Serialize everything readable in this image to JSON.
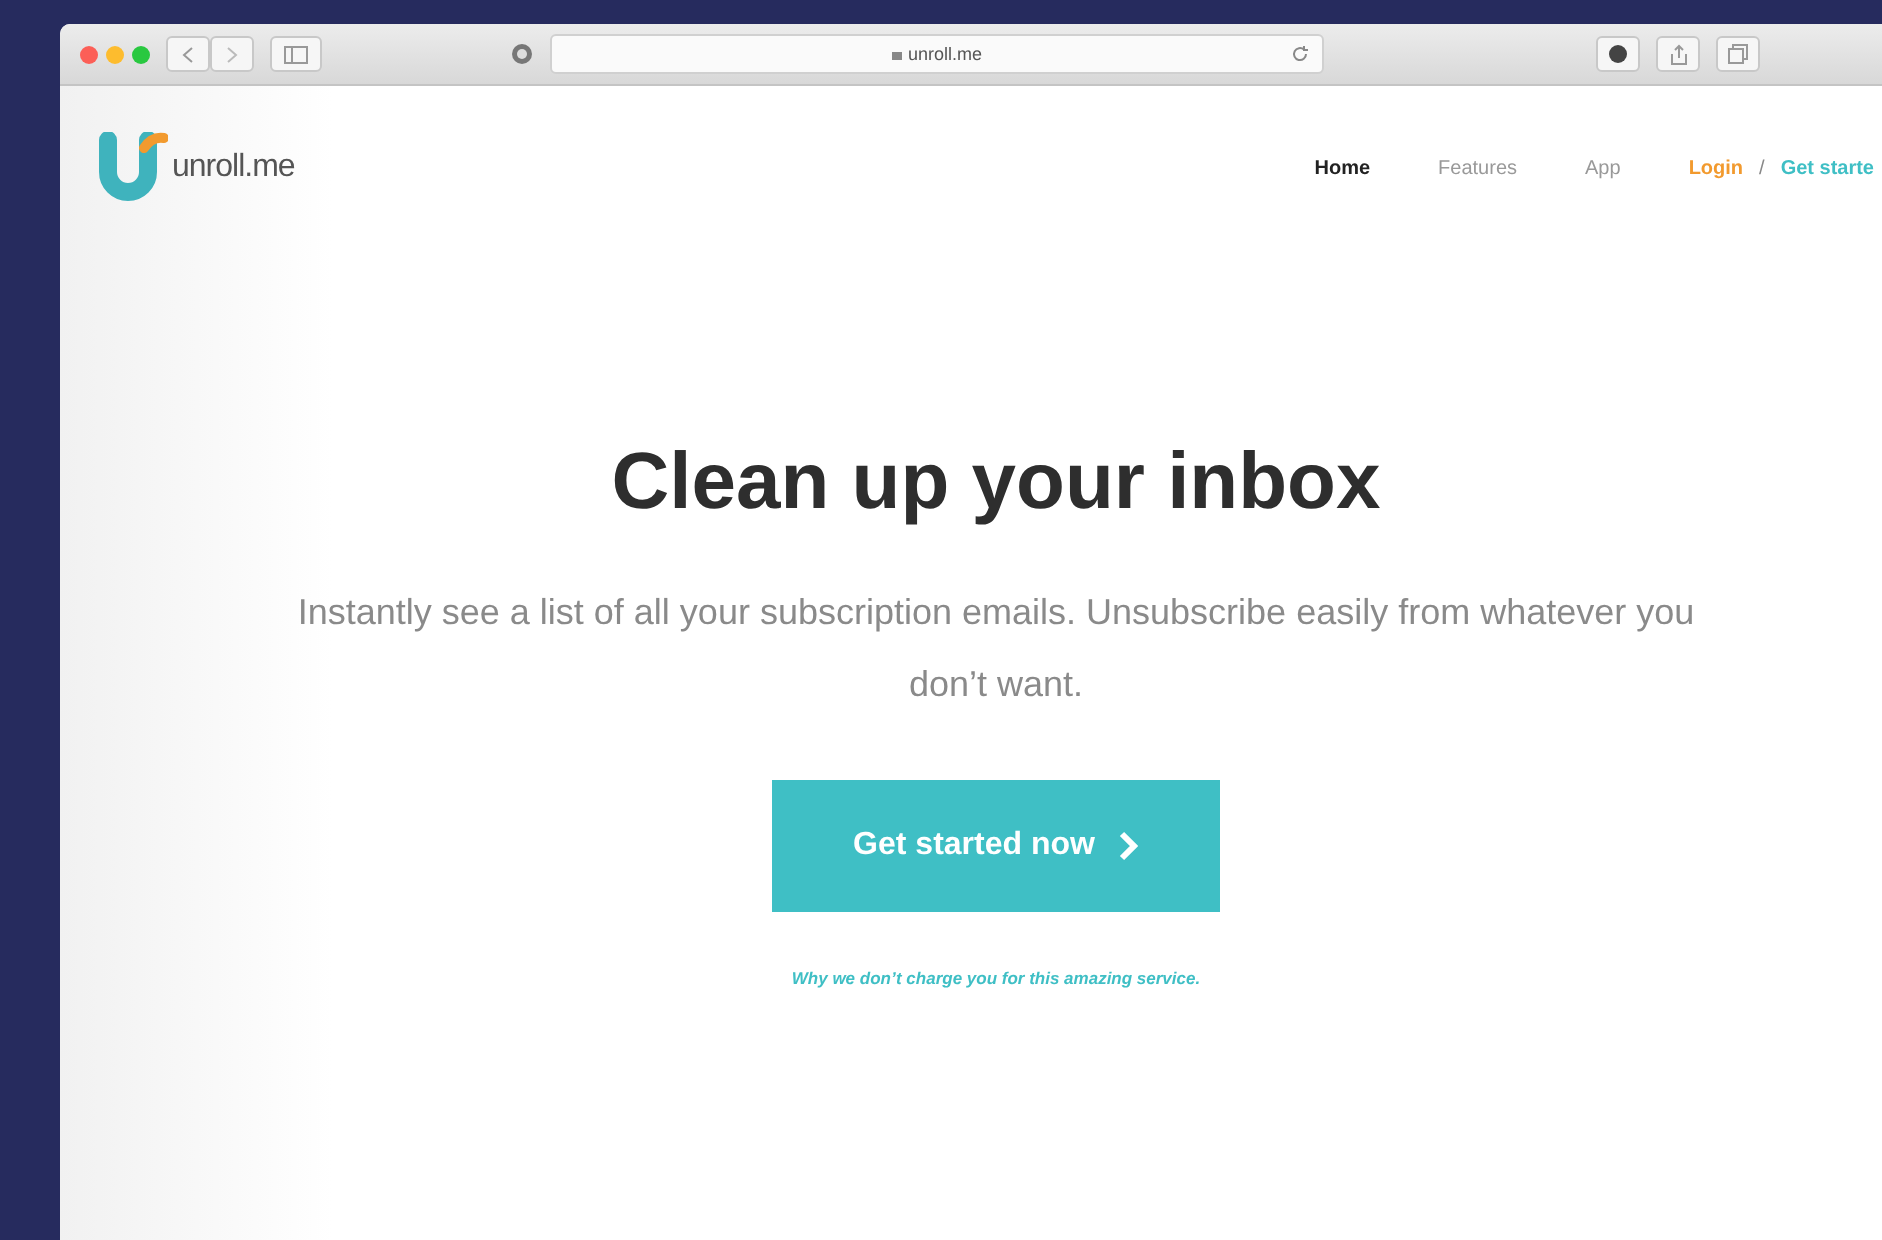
{
  "browser": {
    "address": "unroll.me"
  },
  "site": {
    "logo_text": "unroll.me",
    "nav": [
      {
        "label": "Home",
        "selected": true
      },
      {
        "label": "Features",
        "selected": false
      },
      {
        "label": "App",
        "selected": false
      }
    ],
    "login": "Login",
    "separator": "/",
    "get_started_link": "Get starte"
  },
  "hero": {
    "title": "Clean up your inbox",
    "subtitle": "Instantly see a list of all your subscription emails. Unsubscribe easily from whatever you don’t want.",
    "button": "Get started now",
    "note": "Why we don’t charge you for this amazing service."
  }
}
